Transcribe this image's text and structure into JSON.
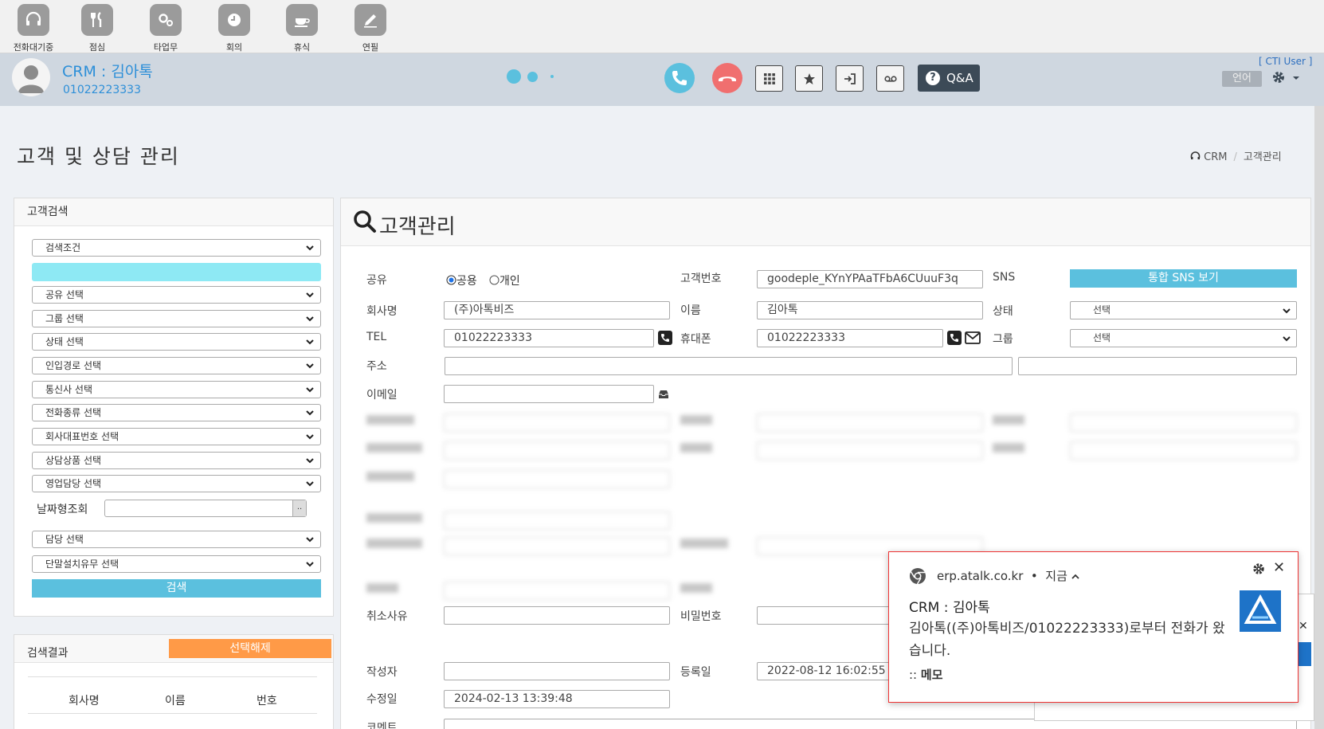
{
  "top_status": [
    {
      "label": "전화대기중",
      "icon": "headset-icon"
    },
    {
      "label": "점심",
      "icon": "utensils-icon"
    },
    {
      "label": "타업무",
      "icon": "gears-icon"
    },
    {
      "label": "회의",
      "icon": "clock-icon"
    },
    {
      "label": "휴식",
      "icon": "coffee-icon"
    },
    {
      "label": "연필",
      "icon": "pencil-icon"
    }
  ],
  "header": {
    "title": "CRM : 김아톡",
    "phone": "01022223333",
    "cti_user": "[ CTI User ]",
    "qa_label": "Q&A",
    "qa_icon_text": "?",
    "lang_label": "언어"
  },
  "page": {
    "title": "고객 및 상담 관리",
    "breadcrumb": [
      "CRM",
      "고객관리"
    ],
    "breadcrumb_sep": "/"
  },
  "search_panel": {
    "title": "고객검색",
    "condition": "검색조건",
    "selects": [
      "공유 선택",
      "그룹 선택",
      "상태 선택",
      "인입경로 선택",
      "통신사 선택",
      "전화종류 선택",
      "회사대표번호 선택",
      "상담상품 선택",
      "영업담당 선택"
    ],
    "date_label": "날짜형조회",
    "date_button": "..",
    "selects2": [
      "담당 선택",
      "단말설치유무 선택"
    ],
    "search_button": "검색"
  },
  "result_panel": {
    "title": "검색결과",
    "deselect_button": "선택해제",
    "columns": [
      "회사명",
      "이름",
      "번호"
    ]
  },
  "main": {
    "title": "고객관리",
    "share_label": "공유",
    "share_options": [
      "공용",
      "개인"
    ],
    "customer_no_label": "고객번호",
    "customer_no": "goodeple_KYnYPAaTFbA6CUuuF3q",
    "sns_label": "SNS",
    "sns_button": "통합 SNS 보기",
    "company_label": "회사명",
    "company": "(주)아톡비즈",
    "name_label": "이름",
    "name": "김아톡",
    "status_label": "상태",
    "status": "선택",
    "tel_label": "TEL",
    "tel": "01022223333",
    "mobile_label": "휴대폰",
    "mobile": "01022223333",
    "group_label": "그룹",
    "group": "선택",
    "address_label": "주소",
    "email_label": "이메일",
    "cancel_reason_label": "취소사유",
    "password_label": "비밀번호",
    "writer_label": "작성자",
    "registered_label": "등록일",
    "registered": "2022-08-12 16:02:55",
    "modified_label": "수정일",
    "modified": "2024-02-13 13:39:48",
    "comment_label": "코멘트"
  },
  "notification": {
    "source": "erp.atalk.co.kr",
    "time": "지금",
    "title": "CRM : 김아톡",
    "body": "김아톡((주)아톡비즈/01022223333)로부터 전화가 왔습니다.",
    "memo_prefix": "::",
    "memo": "메모",
    "close": "✕",
    "side_close": "✕"
  },
  "colors": {
    "accent": "#5bc0de",
    "link": "#2d8fd8",
    "header_bg": "#cfd7e0",
    "deselect": "#ff9a47",
    "call": "#5bc0de",
    "hangup": "#f06f6f"
  }
}
